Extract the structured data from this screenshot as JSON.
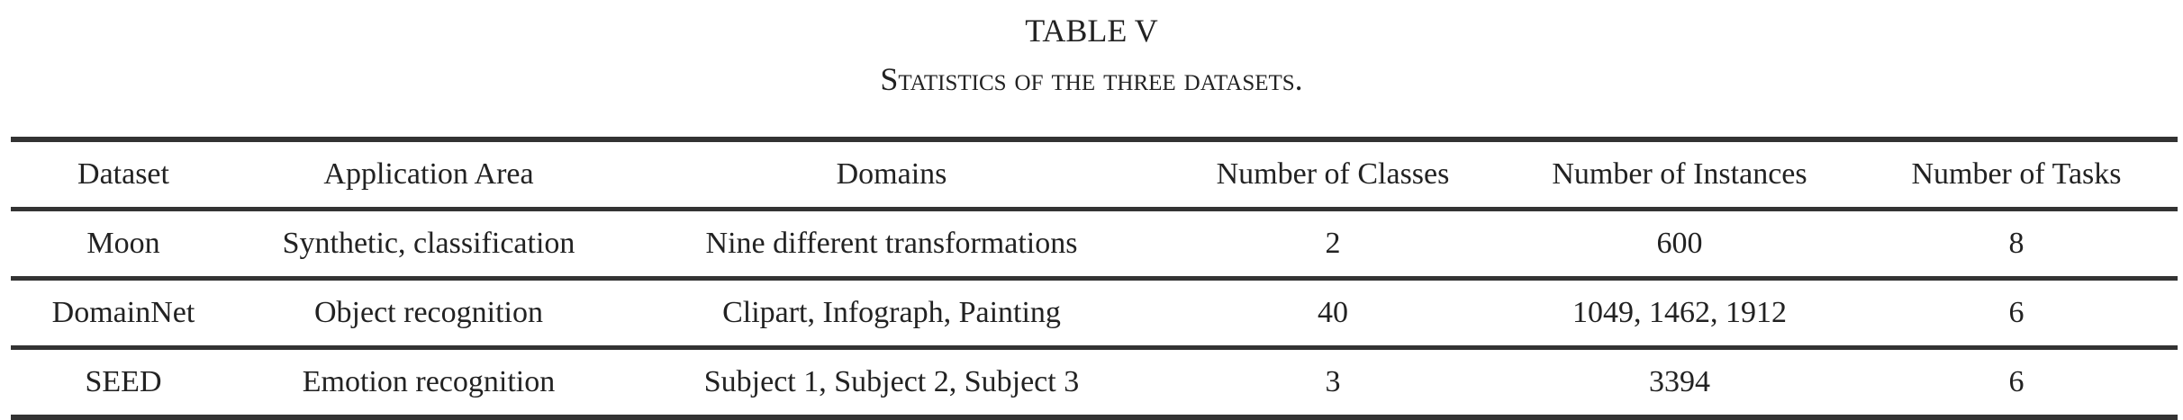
{
  "caption": {
    "label": "TABLE V",
    "title": "Statistics of the three datasets."
  },
  "table": {
    "headers": [
      "Dataset",
      "Application Area",
      "Domains",
      "Number of Classes",
      "Number of Instances",
      "Number of Tasks"
    ],
    "rows": [
      [
        "Moon",
        "Synthetic, classification",
        "Nine different transformations",
        "2",
        "600",
        "8"
      ],
      [
        "DomainNet",
        "Object recognition",
        "Clipart, Infograph, Painting",
        "40",
        "1049, 1462, 1912",
        "6"
      ],
      [
        "SEED",
        "Emotion recognition",
        "Subject 1, Subject 2, Subject 3",
        "3",
        "3394",
        "6"
      ]
    ]
  }
}
